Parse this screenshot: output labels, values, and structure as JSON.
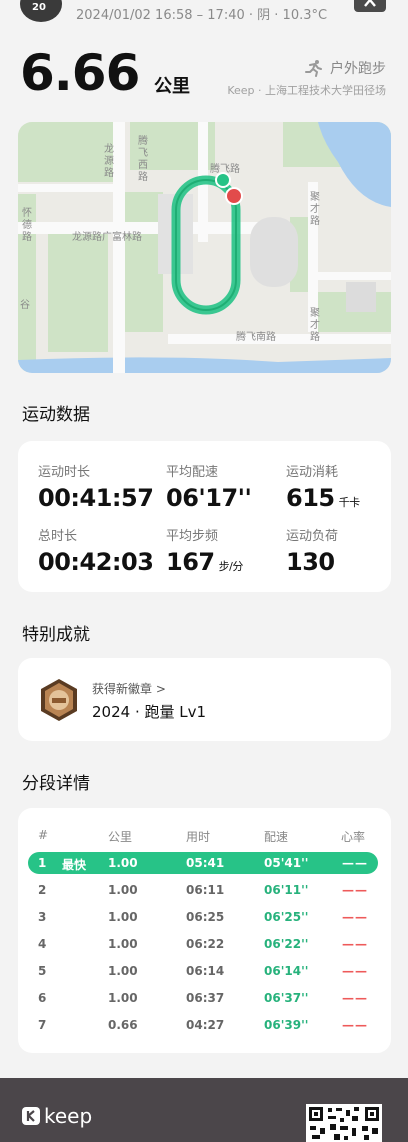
{
  "header": {
    "avatar_text": "20",
    "meta": "2024/01/02 16:58 – 17:40 · 阴 · 10.3°C"
  },
  "summary": {
    "distance": "6.66",
    "distance_unit": "公里",
    "sport_type": "户外跑步",
    "location": "Keep · 上海工程技术大学田径场"
  },
  "map": {
    "labels": [
      "龙源路",
      "腾飞西路",
      "怀德路",
      "龙源路广富林路",
      "腾飞路",
      "聚才路",
      "聚才路",
      "腾飞南路",
      "谷"
    ]
  },
  "workout": {
    "section_title": "运动数据",
    "stats": [
      {
        "label": "运动时长",
        "value": "00:41:57",
        "unit": ""
      },
      {
        "label": "平均配速",
        "value": "06'17''",
        "unit": ""
      },
      {
        "label": "运动消耗",
        "value": "615",
        "unit": "千卡"
      },
      {
        "label": "总时长",
        "value": "00:42:03",
        "unit": ""
      },
      {
        "label": "平均步频",
        "value": "167",
        "unit": "步/分"
      },
      {
        "label": "运动负荷",
        "value": "130",
        "unit": ""
      }
    ]
  },
  "achievement": {
    "section_title": "特别成就",
    "subtitle": "获得新徽章 >",
    "badge_name": "2024 · 跑量 Lv1"
  },
  "splits": {
    "section_title": "分段详情",
    "columns": [
      "#",
      "公里",
      "用时",
      "配速",
      "心率"
    ],
    "fastest_label": "最快",
    "rows": [
      {
        "n": "1",
        "km": "1.00",
        "time": "05:41",
        "pace": "05'41''",
        "hr": "——"
      },
      {
        "n": "2",
        "km": "1.00",
        "time": "06:11",
        "pace": "06'11''",
        "hr": "——"
      },
      {
        "n": "3",
        "km": "1.00",
        "time": "06:25",
        "pace": "06'25''",
        "hr": "——"
      },
      {
        "n": "4",
        "km": "1.00",
        "time": "06:22",
        "pace": "06'22''",
        "hr": "——"
      },
      {
        "n": "5",
        "km": "1.00",
        "time": "06:14",
        "pace": "06'14''",
        "hr": "——"
      },
      {
        "n": "6",
        "km": "1.00",
        "time": "06:37",
        "pace": "06'37''",
        "hr": "——"
      },
      {
        "n": "7",
        "km": "0.66",
        "time": "04:27",
        "pace": "06'39''",
        "hr": "——"
      }
    ]
  },
  "footer": {
    "brand": "keep"
  },
  "colors": {
    "accent_green": "#27c387",
    "heart_red": "#ee5a5a",
    "footer_bg": "#4b464a"
  }
}
